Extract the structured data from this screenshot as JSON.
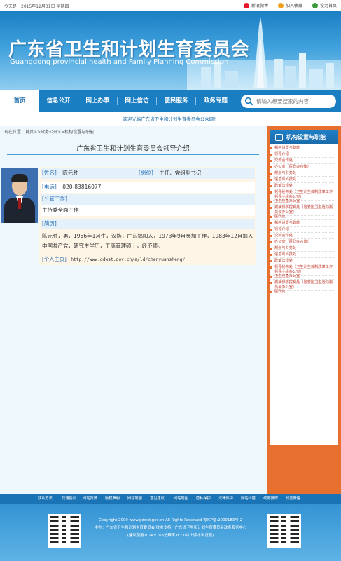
{
  "topbar": {
    "date": "今天是：2015年12月31日 星期四",
    "links": [
      {
        "label": "新浪微博",
        "color": "#e6162d",
        "icon": "weibo-icon"
      },
      {
        "label": "加入收藏",
        "color": "#f0a020",
        "icon": "star-icon"
      },
      {
        "label": "设为首页",
        "color": "#3a9a3a",
        "icon": "home-icon"
      }
    ]
  },
  "banner": {
    "title": "广东省卫生和计划生育委员会",
    "subtitle": "Guangdong provincial health and Family Planning Commission"
  },
  "nav": {
    "items": [
      "首页",
      "信息公开",
      "网上办事",
      "网上信访",
      "便民服务",
      "政务专题"
    ],
    "active_index": 0
  },
  "search": {
    "placeholder": "请输入想要搜索的内容"
  },
  "welcome": "欢迎光临广东省卫生和计划生育委员会公众网！",
  "breadcrumb": "现在位置：首页>>政务公开>>机构设置与职能",
  "page_title": "广东省卫生和计划生育委员会领导介绍",
  "profile": {
    "name_label": "[姓名]",
    "name": "陈元胜",
    "position_label": "[岗位]",
    "position": "主任、党组副书记",
    "phone_label": "[电话]",
    "phone": "020-83816077",
    "duty_label": "[分管工作]",
    "duty": "主持委全面工作",
    "bio_label": "[简历]",
    "bio": "陈元胜，男，1956年1月生，汉族，广东揭阳人，1973年9月参加工作，1983年12月加入中国共产党，研究生学历，工商管理硕士，经济师。",
    "homepage_label": "[个人主页]",
    "homepage": "http://www.gdwst.gov.cn/a/ld/chenyuansheng/"
  },
  "sidebar": {
    "title": "机构设置与职能",
    "items": [
      "机构设置与职能",
      "领导介绍",
      "交流合作处",
      "办公室（医政办合体）",
      "规划与财务处",
      "信息与科技处",
      "政策法规处",
      "领导秘书处（卫生计生体制改革工作领导小组办公室）",
      "卫生应急办公室",
      "疾病预防控制处（省爱国卫生运动委员会办公室）",
      "医政处",
      "机构设置与职能",
      "领导介绍",
      "交流合作处",
      "办公室（医政办合体）",
      "规划与财务处",
      "信息与科技处",
      "政策法规处",
      "领导秘书处（卫生计生体制改革工作领导小组办公室）",
      "卫生应急办公室",
      "疾病预防控制处（省爱国卫生运动委员会办公室）",
      "医政处"
    ]
  },
  "footer": {
    "links": [
      "联系方法",
      "交通指引",
      "网站背景",
      "版权声明",
      "网站地图",
      "意见建议",
      "网站地图",
      "隐私保护",
      "法律保护",
      "网站纠错",
      "政务微博",
      "政务微信"
    ],
    "copyright": "Copyright 2009 www.gdwst.gov.cn All Rights Reserved 粤ICP备:2009183号-2",
    "sponsor": "主办：广东省卫生和计划生育委员会  技术支持：广东省卫生和计划生育委员会政务服务中心",
    "note": "(建议使用1024×768分辨率 IE7.0以上版本浏览器)"
  }
}
